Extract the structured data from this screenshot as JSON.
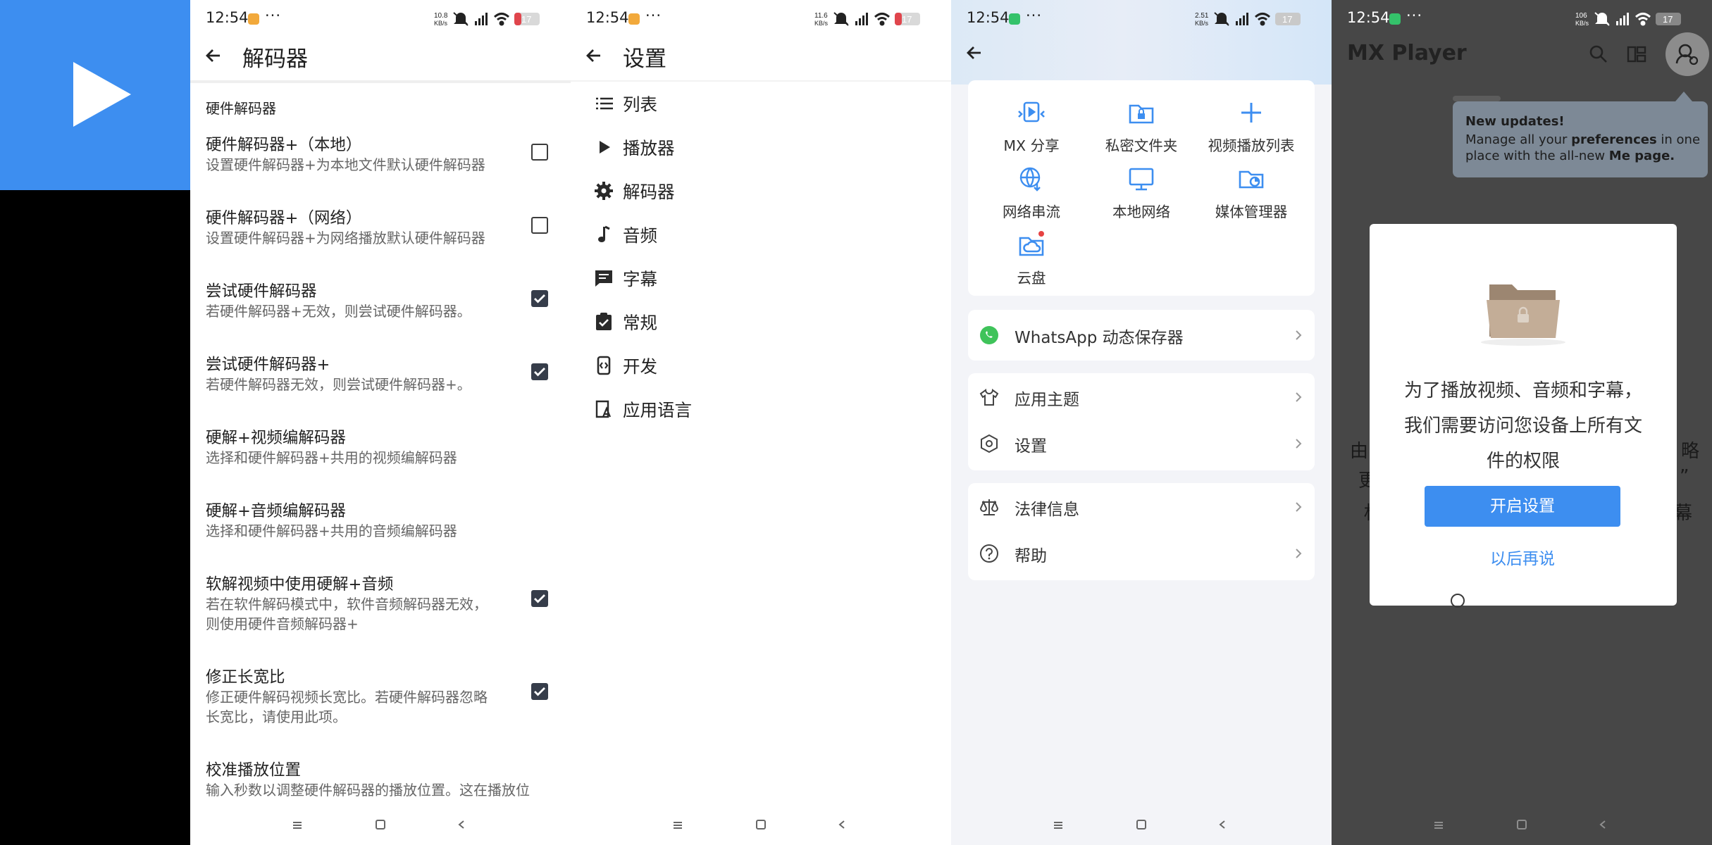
{
  "status": {
    "time": "12:54",
    "battery": "17",
    "net_speeds": [
      "10.8\nKB/s",
      "11.6\nKB/s",
      "2.51\nKB/s",
      "106\nKB/s"
    ],
    "more": "···"
  },
  "app_tile": {
    "icon": "play-icon",
    "color": "#3D8EF0"
  },
  "decoder_screen": {
    "title": "解码器",
    "section_header": "硬件解码器",
    "items": [
      {
        "title": "硬件解码器+（本地）",
        "sub": [
          "设置硬件解码器+为本地文件默认硬件解码器"
        ],
        "checked": false
      },
      {
        "title": "硬件解码器+（网络）",
        "sub": [
          "设置硬件解码器+为网络播放默认硬件解码器"
        ],
        "checked": false
      },
      {
        "title": "尝试硬件解码器",
        "sub": [
          "若硬件解码器+无效，则尝试硬件解码器。"
        ],
        "checked": true
      },
      {
        "title": "尝试硬件解码器+",
        "sub": [
          "若硬件解码器无效，则尝试硬件解码器+。"
        ],
        "checked": true
      },
      {
        "title": "硬解+视频编解码器",
        "sub": [
          "选择和硬件解码器+共用的视频编解码器"
        ],
        "checked": null
      },
      {
        "title": "硬解+音频编解码器",
        "sub": [
          "选择和硬件解码器+共用的音频编解码器"
        ],
        "checked": null
      },
      {
        "title": "软解视频中使用硬解+音频",
        "sub": [
          "若在软件解码模式中，软件音频解码器无效，",
          "则使用硬件音频解码器+"
        ],
        "checked": true
      },
      {
        "title": "修正长宽比",
        "sub": [
          "修正硬件解码视频长宽比。若硬件解码器忽略",
          "长宽比，请使用此项。"
        ],
        "checked": true
      },
      {
        "title": "校准播放位置",
        "sub": [
          "输入秒数以调整硬件解码器的播放位置。这在播放位"
        ],
        "checked": null
      }
    ]
  },
  "settings_screen": {
    "title": "设置",
    "items": [
      {
        "label": "列表",
        "icon": "list-icon"
      },
      {
        "label": "播放器",
        "icon": "play-icon"
      },
      {
        "label": "解码器",
        "icon": "gear-icon"
      },
      {
        "label": "音频",
        "icon": "music-note-icon"
      },
      {
        "label": "字幕",
        "icon": "subtitle-icon"
      },
      {
        "label": "常规",
        "icon": "clipboard-check-icon"
      },
      {
        "label": "开发",
        "icon": "dev-icon"
      },
      {
        "label": "应用语言",
        "icon": "language-icon"
      }
    ]
  },
  "me_screen": {
    "grid": [
      {
        "label": "MX 分享",
        "icon": "share-icon"
      },
      {
        "label": "私密文件夹",
        "icon": "private-folder-icon"
      },
      {
        "label": "视频播放列表",
        "icon": "plus-icon"
      },
      {
        "label": "网络串流",
        "icon": "globe-icon"
      },
      {
        "label": "本地网络",
        "icon": "monitor-icon"
      },
      {
        "label": "媒体管理器",
        "icon": "media-manager-icon"
      },
      {
        "label": "云盘",
        "icon": "cloud-icon"
      }
    ],
    "whatsapp": "WhatsApp 动态保存器",
    "group1": [
      {
        "label": "应用主题",
        "icon": "shirt-icon"
      },
      {
        "label": "设置",
        "icon": "settings-hex-icon"
      }
    ],
    "group2": [
      {
        "label": "法律信息",
        "icon": "scales-icon"
      },
      {
        "label": "帮助",
        "icon": "help-icon"
      }
    ],
    "accent": "#3D8EF0"
  },
  "player_screen": {
    "app_title": "MX Player",
    "tooltip": {
      "title": "New updates!",
      "line1_a": "Manage all your ",
      "line1_b": "preferences",
      "line1_c": " in one",
      "line2_a": "place with the all-new ",
      "line2_b": "Me page."
    },
    "dialog": {
      "lines": [
        "为了播放视频、音频和字幕，",
        "我们需要访问您设备上所有文",
        "件的权限"
      ],
      "primary": "开启设置",
      "secondary": "以后再说"
    },
    "bg_fragments": [
      "由",
      "略",
      "更",
      "”",
      "权",
      "幕"
    ]
  }
}
